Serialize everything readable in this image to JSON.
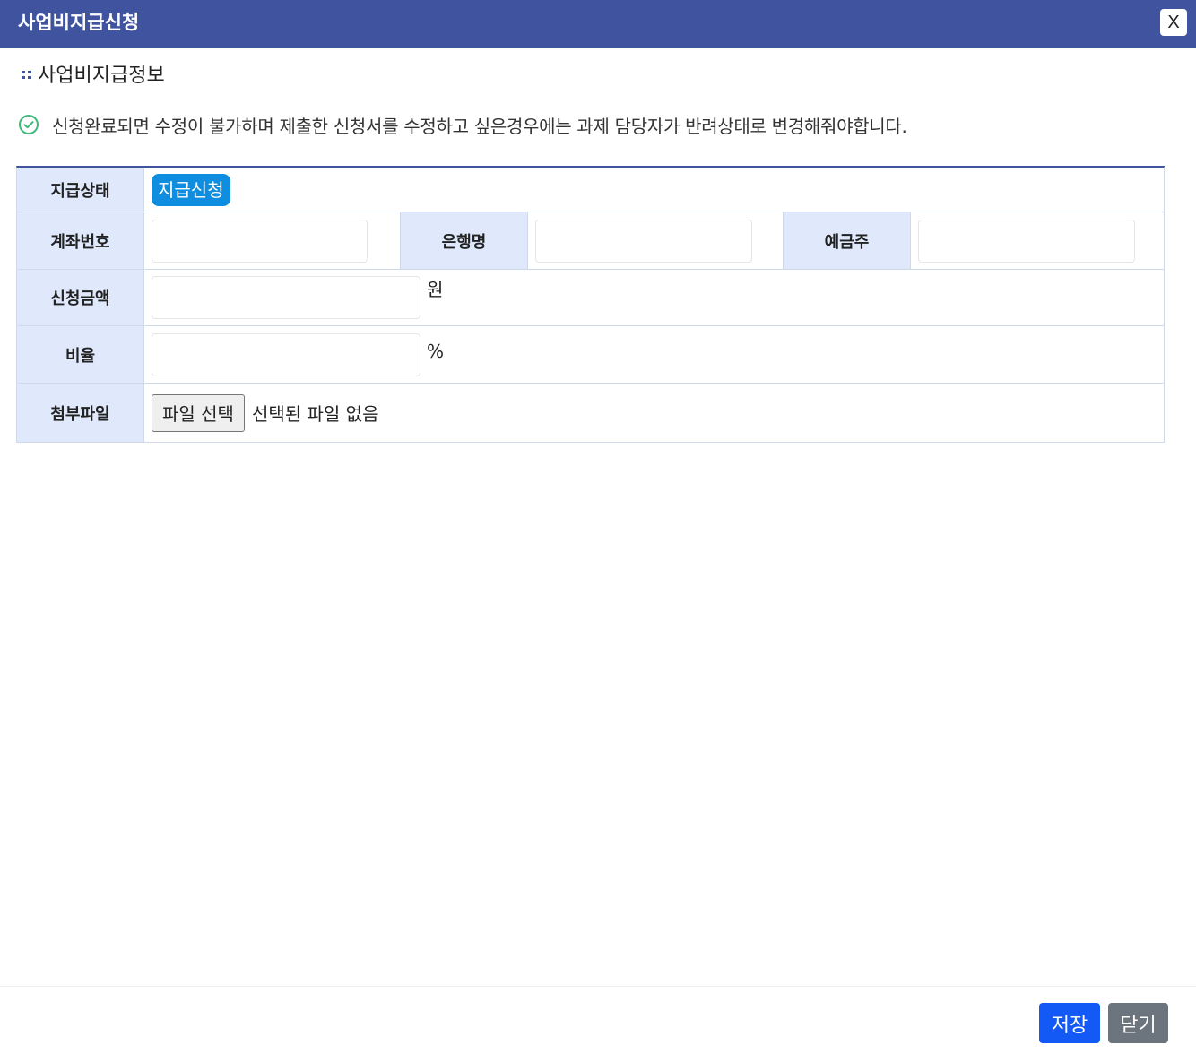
{
  "window": {
    "title": "사업비지급신청",
    "close_label": "X"
  },
  "section": {
    "title": "사업비지급정보"
  },
  "notice": {
    "text": "신청완료되면 수정이 불가하며 제출한 신청서를 수정하고 싶은경우에는 과제 담당자가 반려상태로 변경해줘야합니다."
  },
  "form": {
    "status_label": "지급상태",
    "status_value": "지급신청",
    "account_label": "계좌번호",
    "account_value": "",
    "bank_label": "은행명",
    "bank_value": "",
    "holder_label": "예금주",
    "holder_value": "",
    "amount_label": "신청금액",
    "amount_value": "",
    "amount_unit": "원",
    "ratio_label": "비율",
    "ratio_value": "",
    "ratio_unit": "%",
    "attachment_label": "첨부파일",
    "file_button_label": "파일 선택",
    "file_status": "선택된 파일 없음"
  },
  "footer": {
    "save_label": "저장",
    "close_label": "닫기"
  },
  "colors": {
    "titlebar": "#40539f",
    "header_cell": "#dfe9fb",
    "status_badge": "#0f8ee0",
    "save_button": "#1259f5",
    "close_button": "#6c757d",
    "check_icon": "#3cb878"
  }
}
